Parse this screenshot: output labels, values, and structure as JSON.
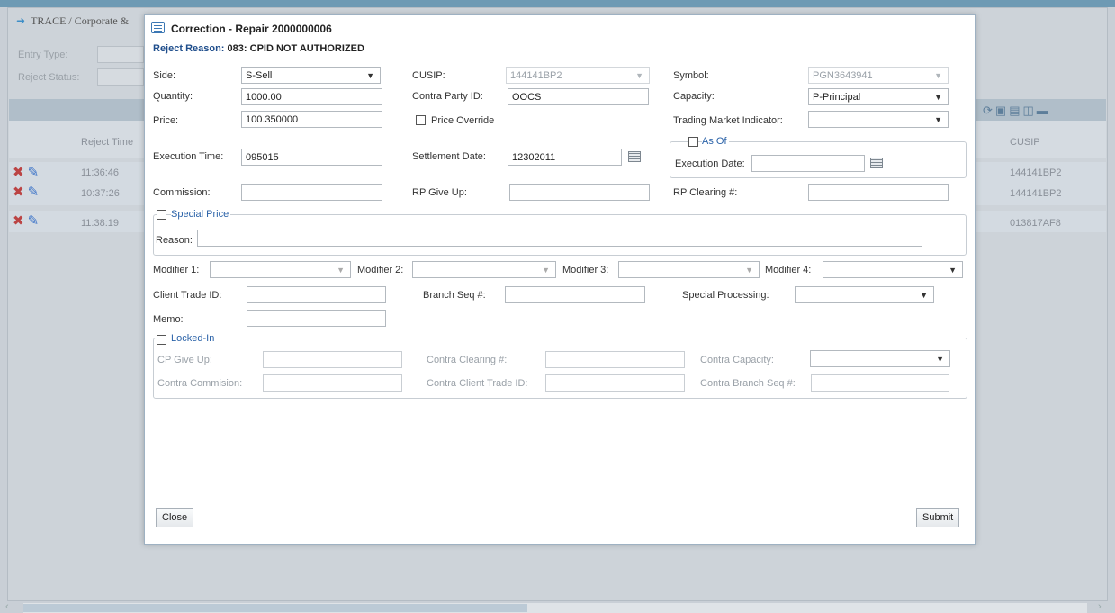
{
  "background": {
    "title": "TRACE / Corporate &",
    "entry_type_label": "Entry Type:",
    "reject_status_label": "Reject Status:",
    "grid": {
      "columns": [
        "Reject Time",
        "CUSIP"
      ],
      "rows": [
        {
          "time": "11:36:46",
          "cusip": "144141BP2"
        },
        {
          "time": "10:37:26",
          "cusip": "144141BP2"
        },
        {
          "time": "11:38:19",
          "cusip": "013817AF8"
        }
      ]
    }
  },
  "dialog": {
    "title": "Correction - Repair 2000000006",
    "reject_reason_label": "Reject Reason:",
    "reject_reason_value": "083: CPID NOT AUTHORIZED",
    "fields": {
      "side": {
        "label": "Side:",
        "value": "S-Sell"
      },
      "cusip": {
        "label": "CUSIP:",
        "value": "144141BP2"
      },
      "symbol": {
        "label": "Symbol:",
        "value": "PGN3643941"
      },
      "quantity": {
        "label": "Quantity:",
        "value": "1000.00"
      },
      "contra_party_id": {
        "label": "Contra Party ID:",
        "value": "OOCS"
      },
      "capacity": {
        "label": "Capacity:",
        "value": "P-Principal"
      },
      "price": {
        "label": "Price:",
        "value": "100.350000"
      },
      "price_override": {
        "label": "Price Override"
      },
      "trading_market_indicator": {
        "label": "Trading Market Indicator:",
        "value": ""
      },
      "execution_time": {
        "label": "Execution Time:",
        "value": "095015"
      },
      "settlement_date": {
        "label": "Settlement Date:",
        "value": "12302011"
      },
      "as_of": {
        "label": "As Of"
      },
      "execution_date": {
        "label": "Execution Date:",
        "value": ""
      },
      "commission": {
        "label": "Commission:",
        "value": ""
      },
      "rp_give_up": {
        "label": "RP Give Up:",
        "value": ""
      },
      "rp_clearing": {
        "label": "RP Clearing #:",
        "value": ""
      },
      "special_price": {
        "label": "Special Price"
      },
      "reason": {
        "label": "Reason:",
        "value": ""
      },
      "modifier1": {
        "label": "Modifier 1:",
        "value": ""
      },
      "modifier2": {
        "label": "Modifier 2:",
        "value": ""
      },
      "modifier3": {
        "label": "Modifier 3:",
        "value": ""
      },
      "modifier4": {
        "label": "Modifier 4:",
        "value": ""
      },
      "client_trade_id": {
        "label": "Client Trade ID:",
        "value": ""
      },
      "branch_seq": {
        "label": "Branch Seq #:",
        "value": ""
      },
      "special_processing": {
        "label": "Special Processing:",
        "value": ""
      },
      "memo": {
        "label": "Memo:",
        "value": ""
      },
      "locked_in": {
        "label": "Locked-In"
      },
      "cp_give_up": {
        "label": "CP Give Up:",
        "value": ""
      },
      "contra_clearing": {
        "label": "Contra Clearing #:",
        "value": ""
      },
      "contra_capacity": {
        "label": "Contra Capacity:",
        "value": ""
      },
      "contra_commission": {
        "label": "Contra Commision:",
        "value": ""
      },
      "contra_client_trade_id": {
        "label": "Contra Client Trade ID:",
        "value": ""
      },
      "contra_branch_seq": {
        "label": "Contra Branch Seq #:",
        "value": ""
      }
    },
    "buttons": {
      "close": "Close",
      "submit": "Submit"
    }
  },
  "icons": {
    "title_arrow": "arrow-right-icon",
    "dialog_icon": "form-icon",
    "calendar": "calendar-icon",
    "row_actions": [
      "delete-icon",
      "edit-icon"
    ],
    "toolbar": [
      "refresh-icon",
      "export-csv-icon",
      "print-icon",
      "save-icon",
      "minimize-icon"
    ]
  },
  "colors": {
    "accent": "#6e9ab4",
    "link": "#1f4e8c"
  }
}
